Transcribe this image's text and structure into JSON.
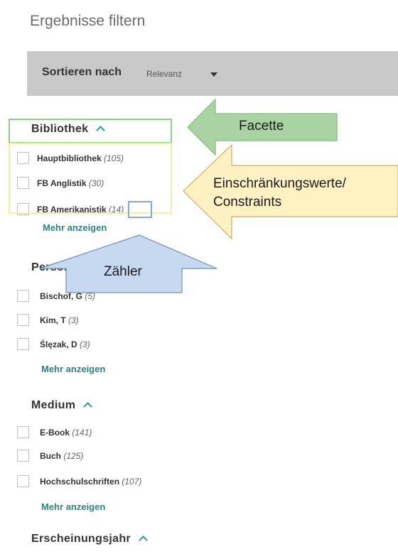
{
  "title": "Ergebnisse filtern",
  "sort": {
    "label": "Sortieren nach",
    "value": "Relevanz"
  },
  "facets": [
    {
      "title": "Bibliothek",
      "items": [
        {
          "label": "Hauptbibliothek",
          "count": "(105)"
        },
        {
          "label": "FB Anglistik",
          "count": "(30)"
        },
        {
          "label": "FB Amerikanistik",
          "count": "(14)"
        }
      ],
      "more": "Mehr anzeigen"
    },
    {
      "title": "Person/Ins",
      "items": [
        {
          "label": "Bischof, G",
          "count": "(5)"
        },
        {
          "label": "Kim, T",
          "count": "(3)"
        },
        {
          "label": "Ślęzak, D",
          "count": "(3)"
        }
      ],
      "more": "Mehr anzeigen"
    },
    {
      "title": "Medium",
      "items": [
        {
          "label": "E-Book",
          "count": "(141)"
        },
        {
          "label": "Buch",
          "count": "(125)"
        },
        {
          "label": "Hochschulschriften",
          "count": "(107)"
        }
      ],
      "more": "Mehr anzeigen"
    },
    {
      "title": "Erscheinungsjahr"
    }
  ],
  "annotations": {
    "facette": "Facette",
    "constraints_line1": "Einschränkungswerte/",
    "constraints_line2": "Constraints",
    "zaehler": "Zähler"
  },
  "colors": {
    "facette_arrow": "#a9d3a2",
    "constraints_arrow": "#fff1c2",
    "zaehler_arrow": "#c6d9f1",
    "teal_link": "#2a8585"
  }
}
